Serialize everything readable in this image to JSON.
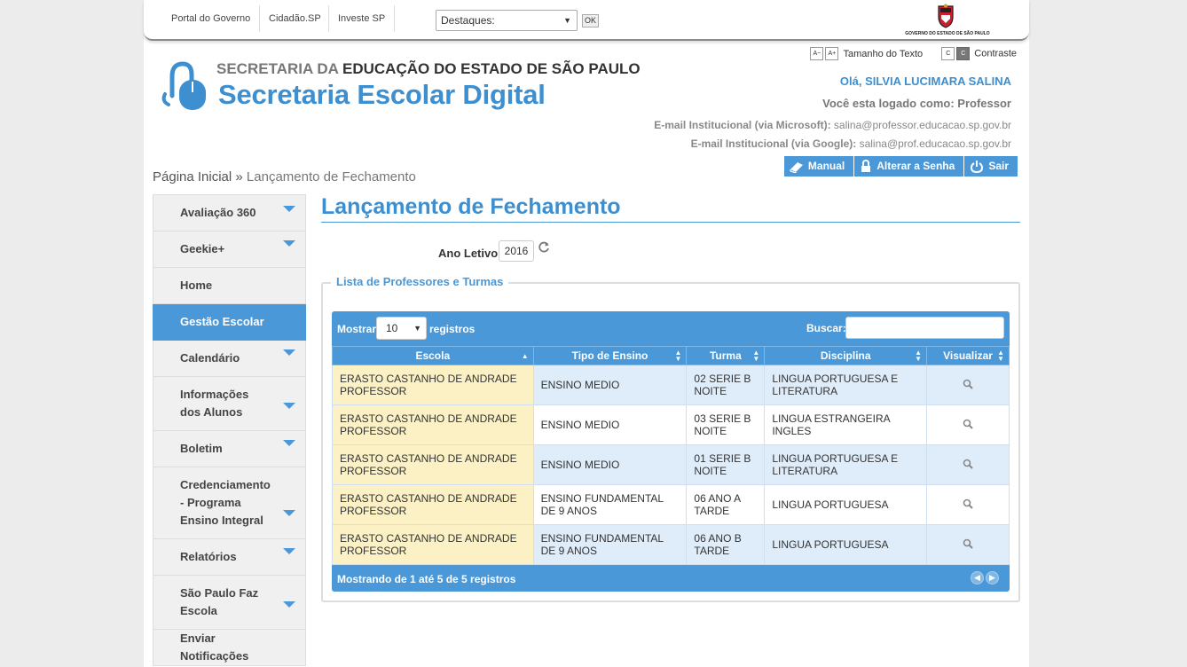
{
  "govbar": {
    "links": [
      "Portal do Governo",
      "Cidadão.SP",
      "Investe SP"
    ],
    "destaques": "Destaques:",
    "ok": "OK",
    "logo_text": "GOVERNO DO ESTADO DE SÃO PAULO"
  },
  "header": {
    "brand_top_light": "SECRETARIA DA",
    "brand_top_bold": "EDUCAÇÃO DO ESTADO DE SÃO PAULO",
    "brand_main": "Secretaria Escolar Digital",
    "a11y": {
      "font_minus": "A−",
      "font_plus": "A+",
      "font_label": "Tamanho do Texto",
      "contrast_light": "C",
      "contrast_dark": "C",
      "contrast_label": "Contraste"
    },
    "greeting": "Olá, SILVIA LUCIMARA SALINA",
    "logged_as": "Você esta logado como: Professor",
    "email_ms_label": "E-mail Institucional (via Microsoft):",
    "email_ms": "salina@professor.educacao.sp.gov.br",
    "email_google_label": "E-mail Institucional (via Google):",
    "email_google": "salina@prof.educacao.sp.gov.br",
    "actions": {
      "manual": "Manual",
      "change_password": "Alterar a Senha",
      "logout": "Sair"
    }
  },
  "breadcrumb": {
    "home": "Página Inicial",
    "sep": "»",
    "current": "Lançamento de Fechamento"
  },
  "sidebar": {
    "items": [
      {
        "label": "Avaliação 360",
        "caret": true
      },
      {
        "label": "Geekie+",
        "caret": true
      },
      {
        "label": "Home",
        "caret": false
      },
      {
        "label": "Gestão Escolar",
        "caret": false,
        "active": true
      },
      {
        "label": "Calendário",
        "caret": true
      },
      {
        "label": "Informações dos Alunos",
        "caret": true
      },
      {
        "label": "Boletim",
        "caret": true
      },
      {
        "label": "Credenciamento - Programa Ensino Integral",
        "caret": true
      },
      {
        "label": "Relatórios",
        "caret": true
      },
      {
        "label": "São Paulo Faz Escola",
        "caret": true
      },
      {
        "label": "Enviar Notificações",
        "caret": false
      }
    ]
  },
  "main": {
    "title": "Lançamento de Fechamento",
    "ano_label": "Ano Letivo:",
    "ano_value": "2016",
    "legend": "Lista de Professores e Turmas",
    "mostrar_label": "Mostrar",
    "page_size": "10",
    "registros_label": "registros",
    "buscar_label": "Buscar:",
    "columns": [
      "Escola",
      "Tipo de Ensino",
      "Turma",
      "Disciplina",
      "Visualizar"
    ],
    "rows": [
      {
        "escola": "ERASTO CASTANHO DE ANDRADE PROFESSOR",
        "tipo": "ENSINO MEDIO",
        "turma": "02 SERIE B NOITE",
        "disciplina": "LINGUA PORTUGUESA E LITERATURA"
      },
      {
        "escola": "ERASTO CASTANHO DE ANDRADE PROFESSOR",
        "tipo": "ENSINO MEDIO",
        "turma": "03 SERIE B NOITE",
        "disciplina": "LINGUA ESTRANGEIRA INGLES"
      },
      {
        "escola": "ERASTO CASTANHO DE ANDRADE PROFESSOR",
        "tipo": "ENSINO MEDIO",
        "turma": "01 SERIE B NOITE",
        "disciplina": "LINGUA PORTUGUESA E LITERATURA"
      },
      {
        "escola": "ERASTO CASTANHO DE ANDRADE PROFESSOR",
        "tipo": "ENSINO FUNDAMENTAL DE 9 ANOS",
        "turma": "06 ANO A TARDE",
        "disciplina": "LINGUA PORTUGUESA"
      },
      {
        "escola": "ERASTO CASTANHO DE ANDRADE PROFESSOR",
        "tipo": "ENSINO FUNDAMENTAL DE 9 ANOS",
        "turma": "06 ANO B TARDE",
        "disciplina": "LINGUA PORTUGUESA"
      }
    ],
    "footer_info": "Mostrando de 1 até 5 de 5 registros"
  },
  "colors": {
    "accent": "#4a98d7",
    "brand_blue": "#3d8fd0",
    "school_cell": "#fbf1c4",
    "row_alt": "#dfedfb"
  }
}
